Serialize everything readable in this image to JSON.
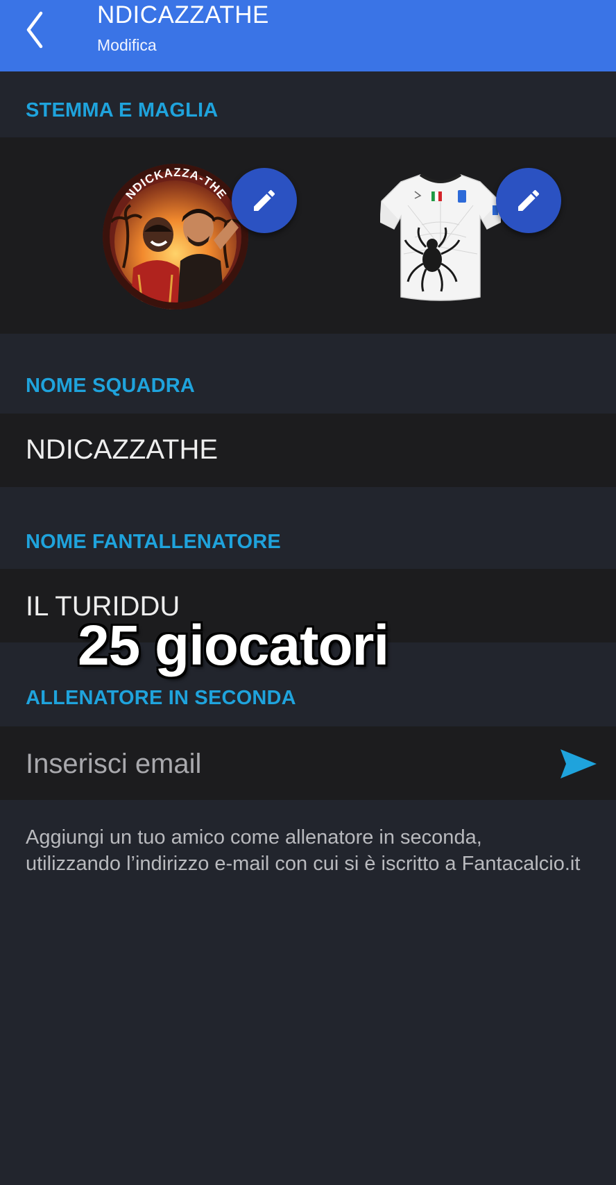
{
  "header": {
    "title": "NDICAZZATHE",
    "subtitle": "Modifica",
    "back_icon": "chevron-left-icon",
    "color": "#3a74e6"
  },
  "crest_section": {
    "label": "STEMMA E MAGLIA",
    "crest_text": "NDICKAZZA-THE",
    "edit_icon": "pencil-icon"
  },
  "team_name": {
    "label": "NOME SQUADRA",
    "value": "NDICAZZATHE"
  },
  "coach_name": {
    "label": "NOME FANTALLENATORE",
    "value": "IL TURIDDU"
  },
  "assistant": {
    "label": "ALLENATORE IN SECONDA",
    "placeholder": "Inserisci email",
    "send_icon": "send-icon",
    "help": "Aggiungi un tuo amico come allenatore in seconda, utilizzando l’indirizzo e-mail con cui si è iscritto a Fantacalcio.it"
  },
  "overlay": {
    "caption": "25 giocatori"
  },
  "colors": {
    "accent": "#1fa3dc",
    "background": "#22252d",
    "band": "#1c1c1e",
    "edit_button": "#2b52c2"
  }
}
